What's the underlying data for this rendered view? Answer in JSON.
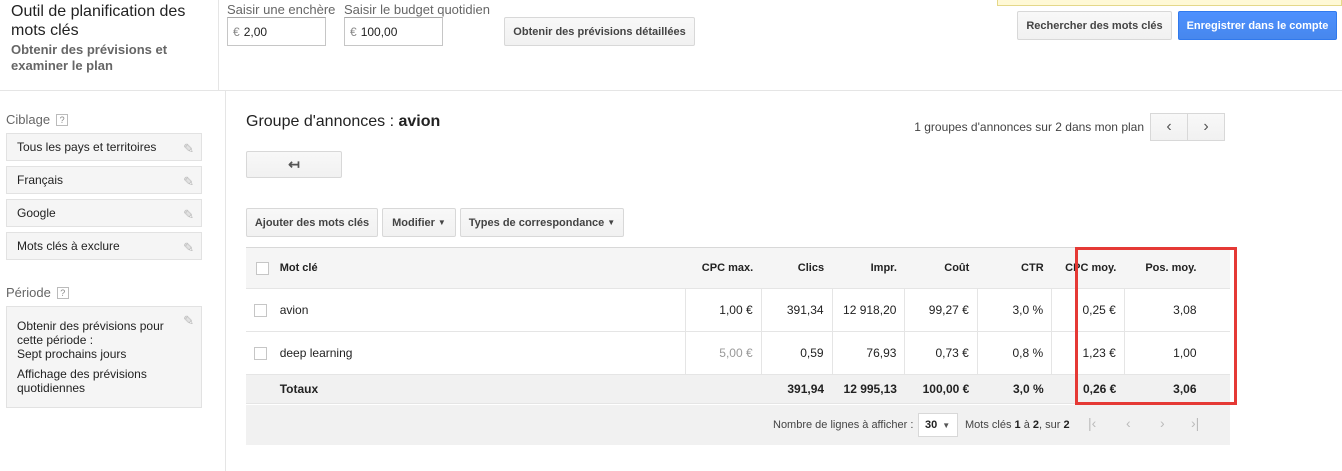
{
  "header": {
    "title": "Outil de planification des mots clés",
    "subtitle": "Obtenir des prévisions et examiner le plan",
    "bid_label": "Saisir une enchère",
    "bid_currency": "€",
    "bid_value": "2,00",
    "budget_label": "Saisir le budget quotidien",
    "budget_currency": "€",
    "budget_value": "100,00",
    "detailed_forecast_button": "Obtenir des prévisions détaillées",
    "search_keywords_button": "Rechercher des mots clés",
    "save_account_button": "Enregistrer dans le compte"
  },
  "sidebar": {
    "targeting_label": "Ciblage",
    "help_glyph": "?",
    "targeting_items": [
      {
        "label": "Tous les pays et territoires"
      },
      {
        "label": "Français"
      },
      {
        "label": "Google"
      },
      {
        "label": "Mots clés à exclure"
      }
    ],
    "period_label": "Période",
    "period_line1": "Obtenir des prévisions pour cette période :",
    "period_line2": "Sept prochains jours",
    "period_line3": "Affichage des prévisions quotidiennes"
  },
  "main": {
    "ad_group_prefix": "Groupe d'annonces : ",
    "ad_group_name": "avion",
    "pager_text": "1 groupes d'annonces sur 2 dans mon plan",
    "toolbar": {
      "add_keywords": "Ajouter des mots clés",
      "modify": "Modifier",
      "match_types": "Types de correspondance"
    },
    "table": {
      "headers": [
        "Mot clé",
        "CPC max.",
        "Clics",
        "Impr.",
        "Coût",
        "CTR",
        "CPC moy.",
        "Pos. moy."
      ],
      "rows": [
        {
          "keyword": "avion",
          "max_cpc": "1,00 €",
          "clicks": "391,34",
          "impressions": "12 918,20",
          "cost": "99,27 €",
          "ctr": "3,0 %",
          "avg_cpc": "0,25 €",
          "avg_pos": "3,08"
        },
        {
          "keyword": "deep learning",
          "max_cpc": "5,00 €",
          "clicks": "0,59",
          "impressions": "76,93",
          "cost": "0,73 €",
          "ctr": "0,8 %",
          "avg_cpc": "1,23 €",
          "avg_pos": "1,00"
        }
      ],
      "totals": {
        "label": "Totaux",
        "clicks": "391,94",
        "impressions": "12 995,13",
        "cost": "100,00 €",
        "ctr": "3,0 %",
        "avg_cpc": "0,26 €",
        "avg_pos": "3,06"
      }
    },
    "footer": {
      "rows_label": "Nombre de lignes à afficher :",
      "rows_value": "30",
      "range_prefix": "Mots clés ",
      "range_from": "1",
      "range_mid": " à ",
      "range_to": "2",
      "range_sep": ", sur ",
      "range_total": "2"
    }
  },
  "colors": {
    "accent_blue": "#4d90fe",
    "highlight_red": "#e53935"
  }
}
